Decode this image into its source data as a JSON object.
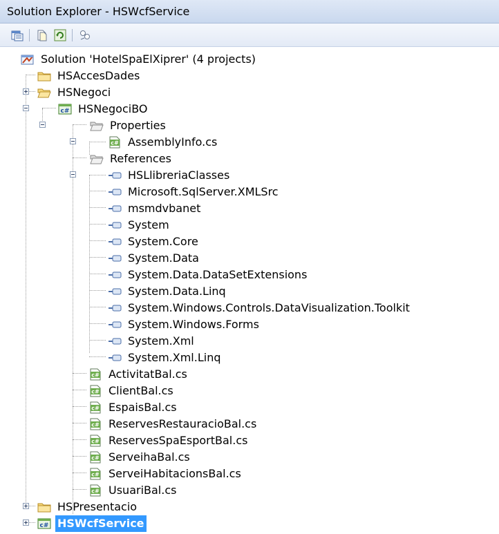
{
  "window": {
    "title": "Solution Explorer - HSWcfService"
  },
  "toolbar": {
    "buttons": [
      {
        "name": "properties-icon"
      },
      {
        "name": "show-all-files-icon"
      },
      {
        "name": "refresh-icon"
      },
      {
        "name": "class-view-icon"
      }
    ]
  },
  "tree": {
    "solution": {
      "label": "Solution 'HotelSpaElXiprer' (4 projects)"
    },
    "hsaccesdades": {
      "label": "HSAccesDades"
    },
    "hsnegoci": {
      "label": "HSNegoci"
    },
    "hsnegocibo": {
      "label": "HSNegociBO"
    },
    "properties": {
      "label": "Properties"
    },
    "assemblyinfo": {
      "label": "AssemblyInfo.cs"
    },
    "references": {
      "label": "References"
    },
    "refs": [
      "HSLlibreriaClasses",
      "Microsoft.SqlServer.XMLSrc",
      "msmdvbanet",
      "System",
      "System.Core",
      "System.Data",
      "System.Data.DataSetExtensions",
      "System.Data.Linq",
      "System.Windows.Controls.DataVisualization.Toolkit",
      "System.Windows.Forms",
      "System.Xml",
      "System.Xml.Linq"
    ],
    "files": [
      "ActivitatBal.cs",
      "ClientBal.cs",
      "EspaisBal.cs",
      "ReservesRestauracioBal.cs",
      "ReservesSpaEsportBal.cs",
      "ServeihaBal.cs",
      "ServeiHabitacionsBal.cs",
      "UsuariBal.cs"
    ],
    "hspresentacio": {
      "label": "HSPresentacio"
    },
    "hswcfservice": {
      "label": "HSWcfService"
    }
  }
}
